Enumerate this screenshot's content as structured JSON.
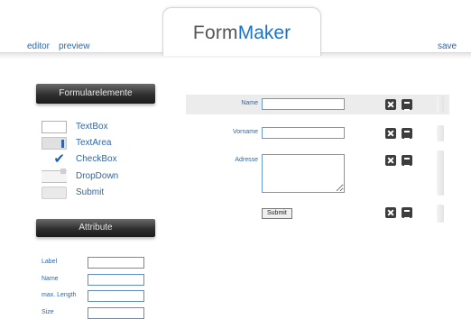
{
  "app": {
    "logo_part1": "Form",
    "logo_part2": "Maker"
  },
  "nav": {
    "editor": "editor",
    "preview": "preview",
    "save": "save"
  },
  "sidebar": {
    "elements_header": "Formularelemente",
    "elements": [
      {
        "label": "TextBox",
        "icon": "textbox-icon"
      },
      {
        "label": "TextArea",
        "icon": "textarea-icon"
      },
      {
        "label": "CheckBox",
        "icon": "checkbox-icon"
      },
      {
        "label": "DropDown",
        "icon": "dropdown-icon"
      },
      {
        "label": "Submit",
        "icon": "submit-icon"
      }
    ],
    "attributes_header": "Attribute",
    "attributes": [
      {
        "label": "Label",
        "value": ""
      },
      {
        "label": "Name",
        "value": ""
      },
      {
        "label": "max. Length",
        "value": ""
      },
      {
        "label": "Size",
        "value": ""
      }
    ]
  },
  "form": {
    "fields": [
      {
        "label": "Name",
        "type": "textbox",
        "value": ""
      },
      {
        "label": "Vorname",
        "type": "textbox",
        "value": ""
      },
      {
        "label": "Adresse",
        "type": "textarea",
        "value": ""
      }
    ],
    "submit_label": "Submit"
  },
  "colors": {
    "accent": "#2b67ad",
    "logo_blue": "#1a73c9",
    "header_dark": "#2f2f2f"
  }
}
